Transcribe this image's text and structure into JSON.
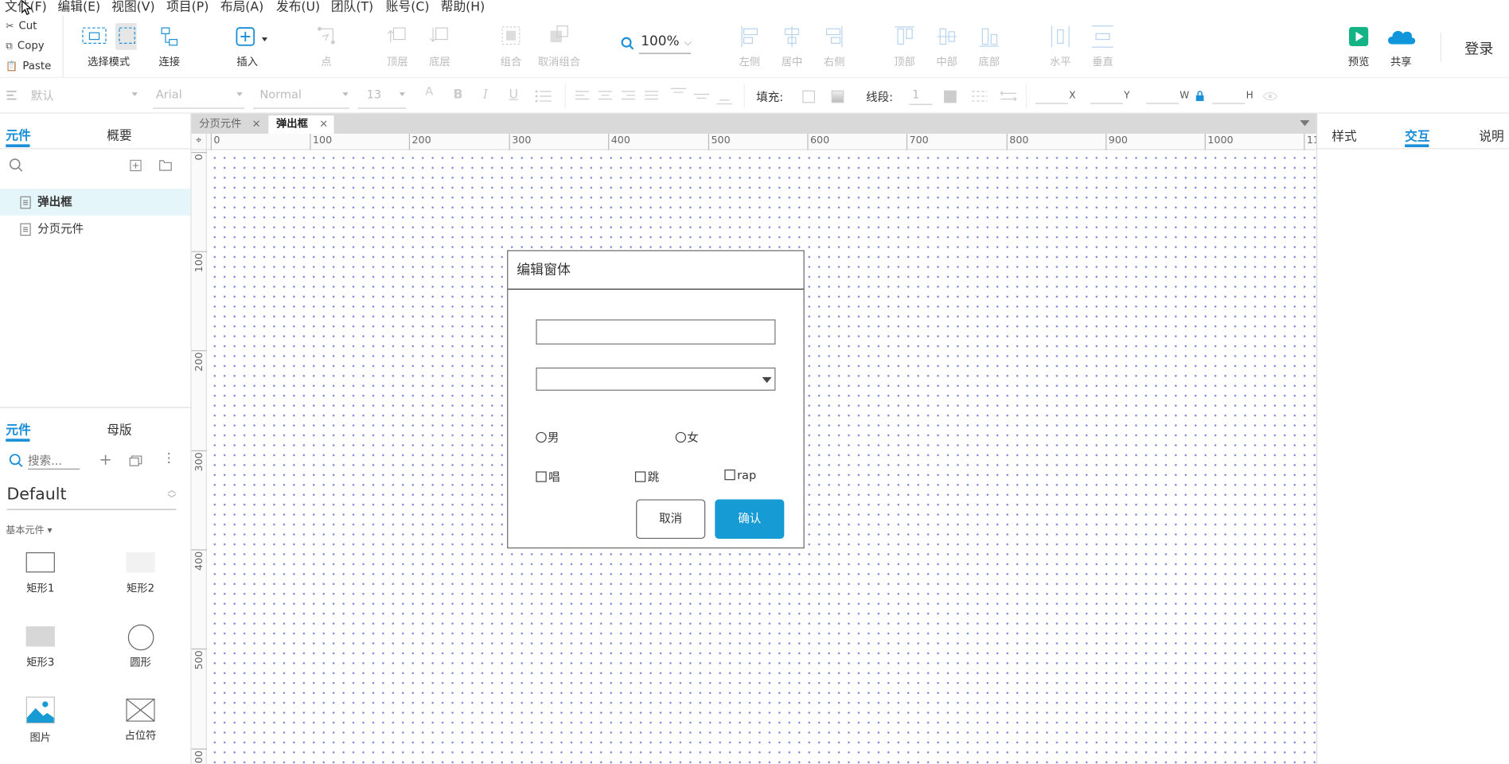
{
  "menu": [
    "文件(F)",
    "编辑(E)",
    "视图(V)",
    "项目(P)",
    "布局(A)",
    "发布(U)",
    "团队(T)",
    "账号(C)",
    "帮助(H)"
  ],
  "clipboard": {
    "cut": "Cut",
    "copy": "Copy",
    "paste": "Paste"
  },
  "toolbar": {
    "select_mode": "选择模式",
    "connect": "连接",
    "insert": "插入",
    "point": "点",
    "top_layer": "顶层",
    "bottom_layer": "底层",
    "group": "组合",
    "ungroup": "取消组合",
    "zoom": "100%",
    "align_left": "左侧",
    "align_center": "居中",
    "align_right": "右侧",
    "align_top": "顶部",
    "align_middle": "中部",
    "align_bottom": "底部",
    "dist_h": "水平",
    "dist_v": "垂直",
    "preview": "预览",
    "share": "共享",
    "login": "登录"
  },
  "format": {
    "style": "默认",
    "font": "Arial",
    "weight": "Normal",
    "size": "13",
    "fill_label": "填充:",
    "line_label": "线段:",
    "line_width": "1",
    "x": "X",
    "y": "Y",
    "w": "W",
    "h": "H"
  },
  "left_top": {
    "tab_components": "元件",
    "tab_outline": "概要",
    "pages": [
      "弹出框",
      "分页元件"
    ]
  },
  "left_bottom": {
    "tab_components": "元件",
    "tab_masters": "母版",
    "search_placeholder": "搜索...",
    "library": "Default",
    "category": "基本元件 ▾",
    "items": [
      "矩形1",
      "矩形2",
      "矩形3",
      "圆形",
      "图片",
      "占位符"
    ]
  },
  "doc_tabs": [
    "分页元件",
    "弹出框"
  ],
  "ruler": {
    "h": [
      "0",
      "100",
      "200",
      "300",
      "400",
      "500",
      "600",
      "700",
      "800",
      "900",
      "1000",
      "11"
    ],
    "v": [
      "0",
      "100",
      "200",
      "300",
      "400",
      "500",
      "00"
    ]
  },
  "dialog": {
    "title": "编辑窗体",
    "radio_male": "男",
    "radio_female": "女",
    "chk_sing": "唱",
    "chk_jump": "跳",
    "chk_rap": "rap",
    "cancel": "取消",
    "confirm": "确认"
  },
  "right_panel": {
    "style": "样式",
    "interact": "交互",
    "notes": "说明"
  },
  "colors": {
    "accent": "#1b8fd8",
    "confirm_btn": "#169bd5",
    "preview_green": "#13b386",
    "share_blue": "#1296db"
  }
}
